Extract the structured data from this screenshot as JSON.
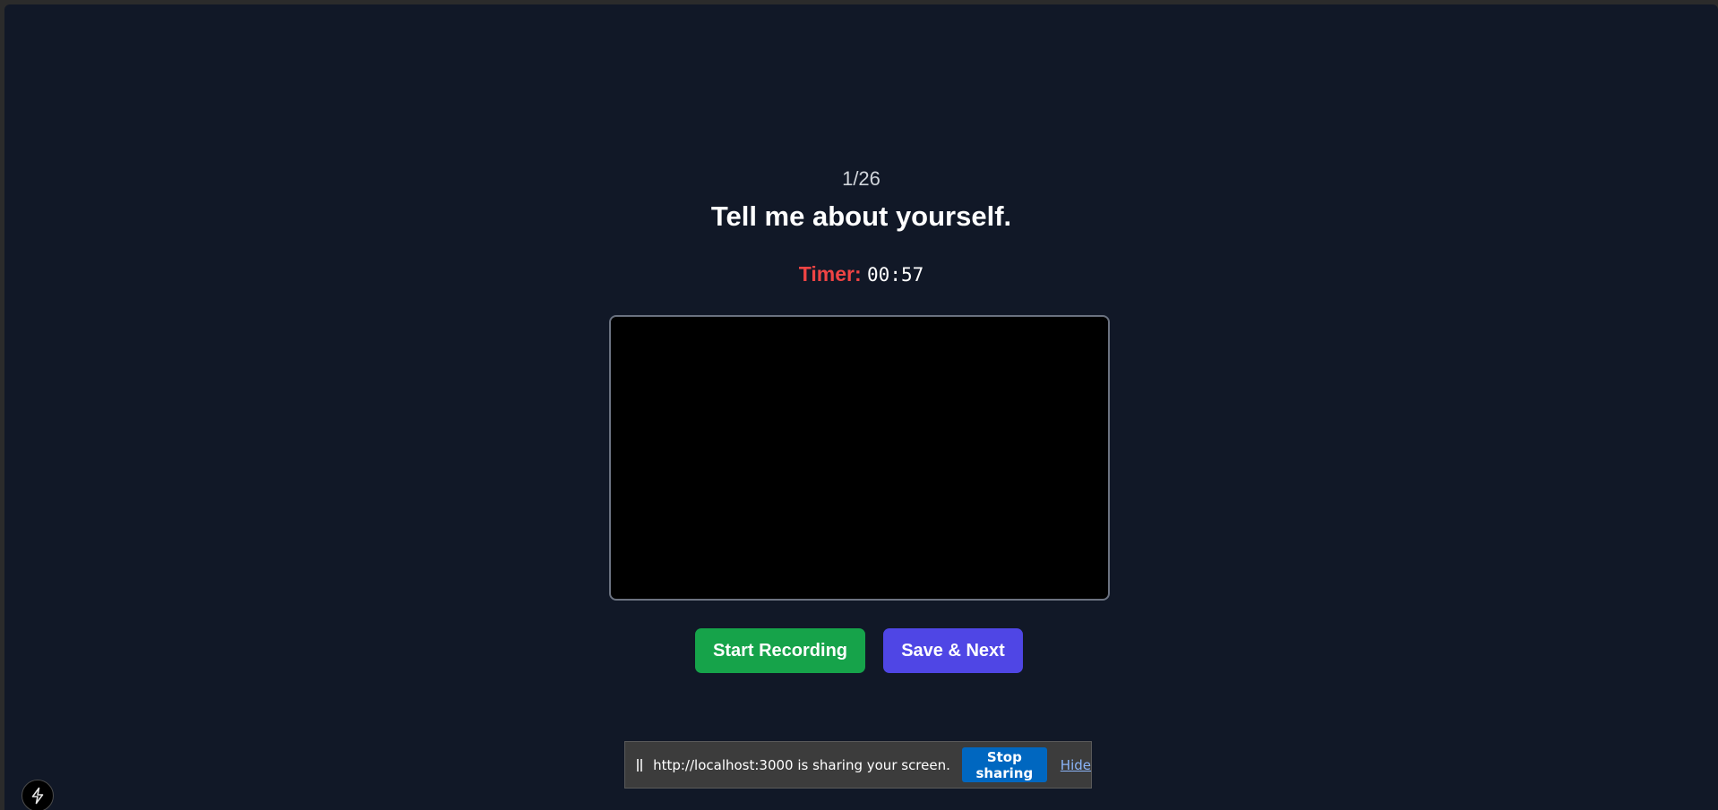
{
  "question_counter": "1/26",
  "question_text": "Tell me about yourself.",
  "timer": {
    "label": "Timer:",
    "value": "00:57"
  },
  "buttons": {
    "start_recording": "Start Recording",
    "save_next": "Save & Next"
  },
  "screen_share_bar": {
    "message": "http://localhost:3000 is sharing your screen.",
    "stop_label": "Stop sharing",
    "hide_label": "Hide"
  },
  "colors": {
    "background": "#111827",
    "timer_label": "#ef4444",
    "start_button": "#16a34a",
    "next_button": "#4f46e5",
    "stop_sharing_button": "#0067c0"
  },
  "icons": {
    "corner_button": "lightning-bolt-icon",
    "share_bar_grip": "grip-handle-icon"
  }
}
